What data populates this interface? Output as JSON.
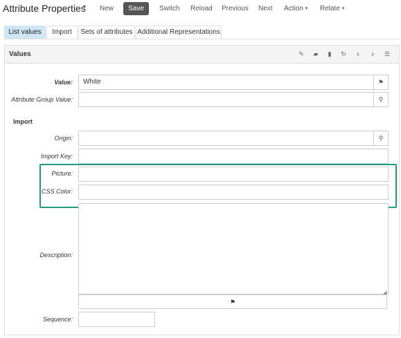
{
  "toolbar": {
    "title": "Attribute Properties",
    "menu_caret": "▾",
    "new_label": "New",
    "save_label": "Save",
    "switch_label": "Switch",
    "reload_label": "Reload",
    "previous_label": "Previous",
    "next_label": "Next",
    "action_label": "Action",
    "relate_label": "Relate",
    "dropdown_caret": "▾"
  },
  "tabs": [
    {
      "label": "List values",
      "active": true
    },
    {
      "label": "Import",
      "active": false
    },
    {
      "label": "Sets of attributes",
      "active": false
    },
    {
      "label": "Additional Representations",
      "active": false
    }
  ],
  "panel": {
    "title": "Values",
    "header_icons": {
      "edit": "✎",
      "open": "▰",
      "delete": "▮",
      "reload": "↻",
      "previous": "‹",
      "next": "›",
      "switch_view": "☰"
    }
  },
  "form": {
    "value_label": "Value:",
    "value": "White",
    "value_flag_icon": "⚑",
    "attribute_group_value_label": "Attribute Group Value:",
    "search_icon": "⚲",
    "import_section": "Import",
    "origin_label": "Origin:",
    "import_key_label": "Import Key:",
    "picture_label": "Picture:",
    "css_color_label": "CSS Color:",
    "description_label": "Description:",
    "description_flag_icon": "⚑",
    "sequence_label": "Sequence:"
  },
  "colors": {
    "accent": "#1e9e7c",
    "active_tab": "#cfe6f5",
    "save_button": "#555555"
  }
}
